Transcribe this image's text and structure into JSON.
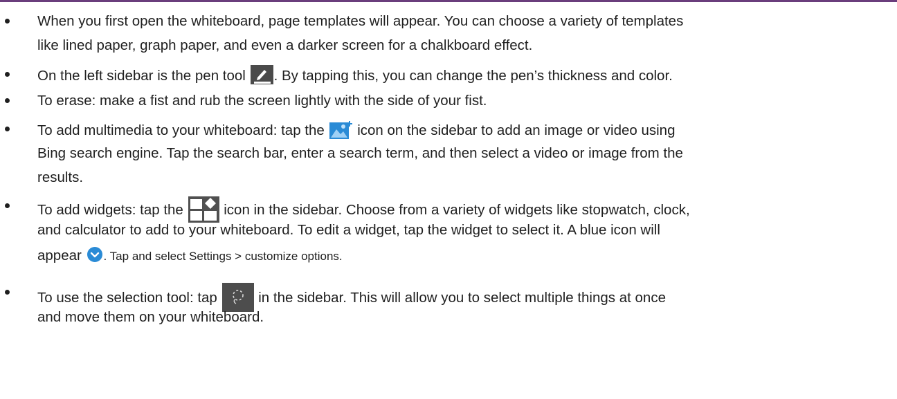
{
  "bullets": [
    {
      "lines": [
        "When you first open the whiteboard, page templates will appear. You can choose a variety of templates",
        "like lined paper, graph paper, and even a darker screen for a chalkboard effect."
      ]
    },
    {
      "before": "On the left sidebar is the pen tool",
      "after": ". By tapping this, you can change the pen’s thickness and color.",
      "icon": "pen-icon"
    },
    {
      "lines": [
        "To erase: make a fist and rub the screen lightly with the side of your fist."
      ]
    },
    {
      "before": "To add multimedia to your whiteboard: tap the",
      "after": "icon on the sidebar to add an image or video using",
      "icon": "add-media-icon",
      "lines": [
        "Bing search engine. Tap the search bar, enter a search term, and then select a video or image from the",
        "results."
      ]
    },
    {
      "before": "To add widgets: tap the",
      "after": "icon in the sidebar. Choose from a variety of widgets like stopwatch, clock,",
      "icon": "widgets-icon",
      "lines": [
        "and calculator to add to your whiteboard. To edit a widget, tap the widget to select it. A blue icon will"
      ],
      "last_before": "appear",
      "last_icon": "chevron-down-circle-icon",
      "last_after": ". Tap and select Settings > customize options."
    },
    {
      "before": "To use the selection tool: tap",
      "after": "in the sidebar. This will allow you to select multiple things at once",
      "icon": "lasso-select-icon",
      "lines": [
        "and move them on your whiteboard."
      ]
    }
  ],
  "colors": {
    "accent_rule": "#6a3d7c",
    "icon_blue": "#2a8bd6",
    "icon_dark": "#4a4a4a"
  }
}
